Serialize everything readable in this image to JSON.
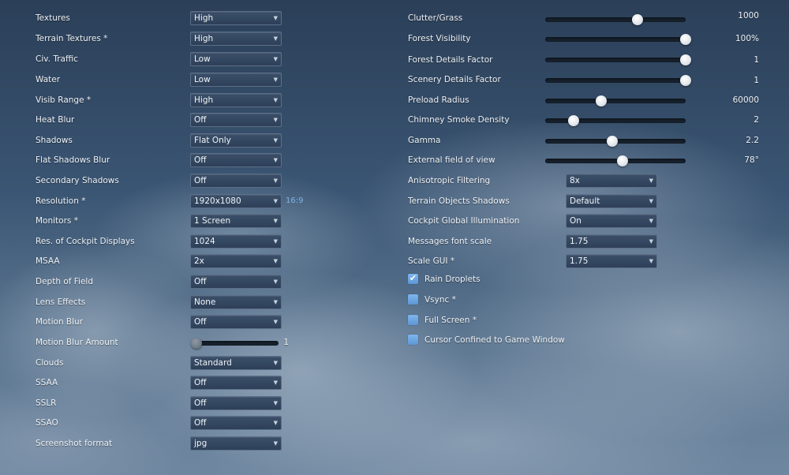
{
  "left": {
    "dropdowns": [
      {
        "label": "Textures",
        "value": "High"
      },
      {
        "label": "Terrain Textures *",
        "value": "High"
      },
      {
        "label": "Civ. Traffic",
        "value": "Low"
      },
      {
        "label": "Water",
        "value": "Low"
      },
      {
        "label": "Visib Range *",
        "value": "High"
      },
      {
        "label": "Heat Blur",
        "value": "Off"
      },
      {
        "label": "Shadows",
        "value": "Flat Only"
      },
      {
        "label": "Flat Shadows Blur",
        "value": "Off"
      },
      {
        "label": "Secondary Shadows",
        "value": "Off"
      },
      {
        "label": "Resolution *",
        "value": "1920x1080"
      },
      {
        "label": "Monitors *",
        "value": "1 Screen"
      },
      {
        "label": "Res. of Cockpit Displays",
        "value": "1024"
      },
      {
        "label": "MSAA",
        "value": "2x"
      },
      {
        "label": "Depth of Field",
        "value": "Off"
      },
      {
        "label": "Lens Effects",
        "value": "None"
      },
      {
        "label": "Motion Blur",
        "value": "Off"
      },
      {
        "label": "Clouds",
        "value": "Standard"
      },
      {
        "label": "SSAA",
        "value": "Off"
      },
      {
        "label": "SSLR",
        "value": "Off"
      },
      {
        "label": "SSAO",
        "value": "Off"
      },
      {
        "label": "Screenshot format",
        "value": "jpg"
      }
    ],
    "aspect_ratio": "16:9",
    "motion_blur_amount": {
      "label": "Motion Blur Amount",
      "value": "1",
      "fraction": 0.0
    }
  },
  "right": {
    "sliders": [
      {
        "label": "Clutter/Grass",
        "value": "1000",
        "fraction": 0.66
      },
      {
        "label": "Forest Visibility",
        "value": "100%",
        "fraction": 1.0
      },
      {
        "label": "Forest Details Factor",
        "value": "1",
        "fraction": 1.0
      },
      {
        "label": "Scenery Details Factor",
        "value": "1",
        "fraction": 1.0
      },
      {
        "label": "Preload Radius",
        "value": "60000",
        "fraction": 0.4
      },
      {
        "label": "Chimney Smoke Density",
        "value": "2",
        "fraction": 0.2
      },
      {
        "label": "Gamma",
        "value": "2.2",
        "fraction": 0.48
      },
      {
        "label": "External field of view",
        "value": "78°",
        "fraction": 0.55
      }
    ],
    "dropdowns": [
      {
        "label": "Anisotropic Filtering",
        "value": "8x"
      },
      {
        "label": "Terrain Objects Shadows",
        "value": "Default"
      },
      {
        "label": "Cockpit Global Illumination",
        "value": "On"
      },
      {
        "label": "Messages font scale",
        "value": "1.75"
      },
      {
        "label": "Scale GUI *",
        "value": "1.75"
      }
    ],
    "checkboxes": [
      {
        "label": "Rain Droplets",
        "checked": true
      },
      {
        "label": "Vsync *",
        "checked": false
      },
      {
        "label": "Full Screen *",
        "checked": false
      },
      {
        "label": "Cursor Confined to Game Window",
        "checked": false
      }
    ]
  },
  "icons": {
    "dropdown_arrow": "chevron-down-icon",
    "checkmark": "checkmark-icon"
  },
  "colors": {
    "accent": "#6aa6e6",
    "aspect_text": "#7fb2e0",
    "panel": "#33475f"
  }
}
